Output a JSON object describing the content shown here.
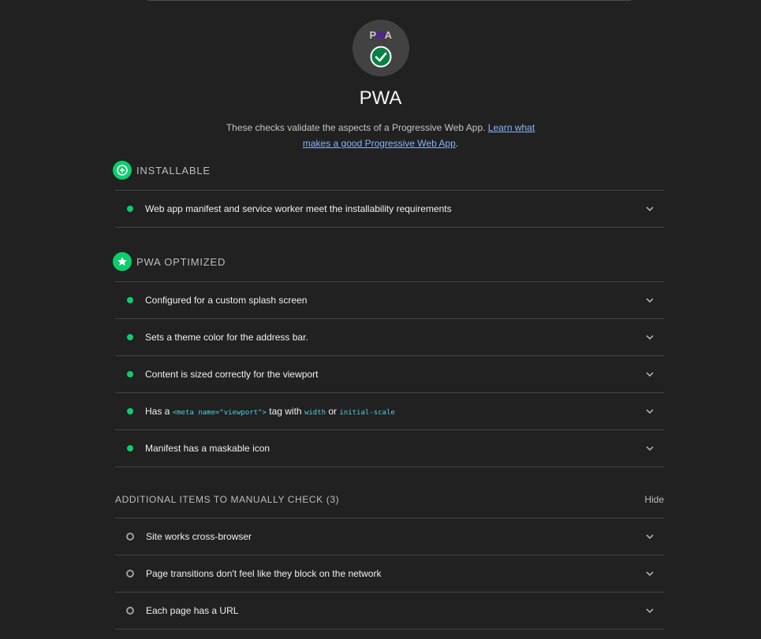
{
  "category": {
    "badge_text_1": "P",
    "badge_text_2": "W",
    "badge_text_3": "A",
    "title": "PWA",
    "description": "These checks validate the aspects of a Progressive Web App. ",
    "learn_more_link": "Learn what makes a good Progressive Web App",
    "description_end": "."
  },
  "groups": {
    "installable": {
      "label": "INSTALLABLE",
      "audits": [
        "Web app manifest and service worker meet the installability requirements"
      ]
    },
    "optimized": {
      "label": "PWA OPTIMIZED",
      "audits": [
        "Configured for a custom splash screen",
        "Sets a theme color for the address bar.",
        "Content is sized correctly for the viewport",
        "Manifest has a maskable icon"
      ],
      "viewport_audit": {
        "pre": "Has a ",
        "code1": "<meta name=\"viewport\">",
        "mid": " tag with ",
        "code2": "width",
        "or": " or ",
        "code3": "initial-scale"
      }
    },
    "manual": {
      "label": "ADDITIONAL ITEMS TO MANUALLY CHECK (3)",
      "toggle": "Hide",
      "audits": [
        "Site works cross-browser",
        "Page transitions don't feel like they block on the network",
        "Each page has a URL"
      ]
    }
  },
  "colors": {
    "pass": "#0cce6b",
    "link": "#8ab4f8",
    "code": "#4dd0e1",
    "background": "#212121"
  },
  "icons": {
    "installable": "plus-circle-icon",
    "optimized": "star-icon",
    "pass": "check-circle-icon",
    "expand": "chevron-down-icon"
  }
}
